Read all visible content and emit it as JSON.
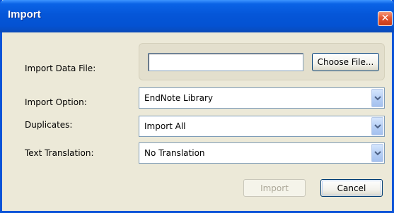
{
  "window": {
    "title": "Import",
    "close_glyph": "✕"
  },
  "form": {
    "import_data_file": {
      "label": "Import Data File:",
      "value": "",
      "choose_button_label": "Choose File..."
    },
    "import_option": {
      "label": "Import Option:",
      "selected": "EndNote Library"
    },
    "duplicates": {
      "label": "Duplicates:",
      "selected": "Import All"
    },
    "text_translation": {
      "label": "Text Translation:",
      "selected": "No Translation"
    }
  },
  "buttons": {
    "import_label": "Import",
    "import_enabled": false,
    "cancel_label": "Cancel"
  },
  "icons": {
    "close": "close-icon",
    "dropdown": "chevron-down-icon"
  },
  "colors": {
    "titlebar": "#0556d8",
    "dialog_bg": "#ece9d8",
    "close_button": "#e2542f",
    "disabled_text": "#aca899"
  }
}
